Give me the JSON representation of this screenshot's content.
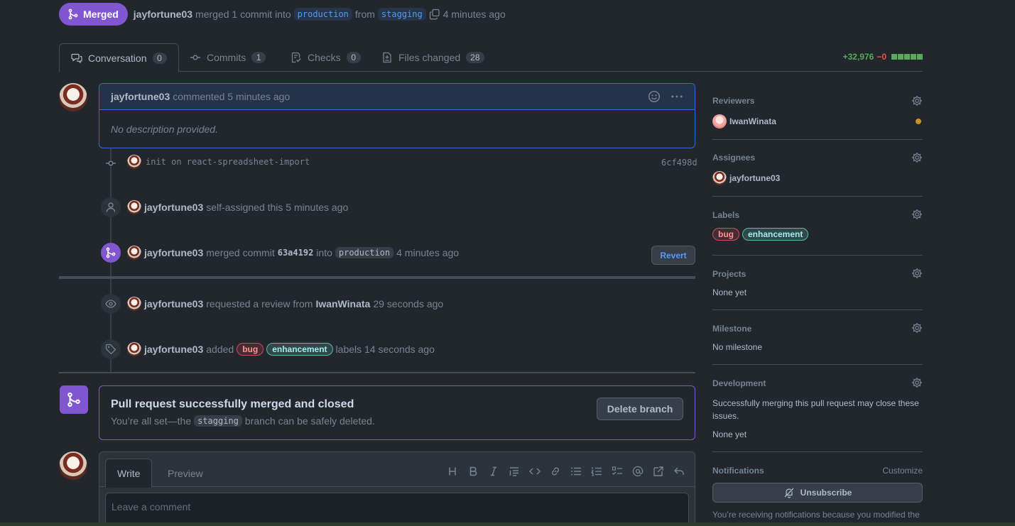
{
  "header": {
    "status": "Merged",
    "author": "jayfortune03",
    "merged_text": "merged 1 commit into",
    "base_branch": "production",
    "from_text": "from",
    "head_branch": "stagging",
    "time": "4 minutes ago"
  },
  "tabs": [
    {
      "label": "Conversation",
      "count": "0"
    },
    {
      "label": "Commits",
      "count": "1"
    },
    {
      "label": "Checks",
      "count": "0"
    },
    {
      "label": "Files changed",
      "count": "28"
    }
  ],
  "diffstat": {
    "additions": "+32,976",
    "deletions": "−0"
  },
  "comment": {
    "author": "jayfortune03",
    "action": "commented 5 minutes ago",
    "body": "No description provided."
  },
  "commit": {
    "message": "init on react-spreadsheet-import",
    "sha": "6cf498d"
  },
  "events": {
    "assigned": {
      "actor": "jayfortune03",
      "text": "self-assigned this 5 minutes ago"
    },
    "merged": {
      "actor": "jayfortune03",
      "text1": "merged commit",
      "sha": "63a4192",
      "text2": "into",
      "branch": "production",
      "time": "4 minutes ago",
      "revert_label": "Revert"
    },
    "review": {
      "actor": "jayfortune03",
      "text": "requested a review from",
      "reviewer": "IwanWinata",
      "time": "29 seconds ago"
    },
    "labels": {
      "actor": "jayfortune03",
      "text": "added",
      "label1": "bug",
      "label2": "enhancement",
      "time": "labels 14 seconds ago"
    }
  },
  "merge_box": {
    "title": "Pull request successfully merged and closed",
    "sub1": "You’re all set—the",
    "branch": "stagging",
    "sub2": "branch can be safely deleted.",
    "delete_label": "Delete branch"
  },
  "write": {
    "tab_write": "Write",
    "tab_preview": "Preview",
    "placeholder": "Leave a comment"
  },
  "sidebar": {
    "reviewers": {
      "title": "Reviewers",
      "user": "IwanWinata"
    },
    "assignees": {
      "title": "Assignees",
      "user": "jayfortune03"
    },
    "labels": {
      "title": "Labels",
      "label1": "bug",
      "label2": "enhancement"
    },
    "projects": {
      "title": "Projects",
      "value": "None yet"
    },
    "milestone": {
      "title": "Milestone",
      "value": "No milestone"
    },
    "development": {
      "title": "Development",
      "desc": "Successfully merging this pull request may close these issues.",
      "value": "None yet"
    },
    "notifications": {
      "title": "Notifications",
      "customize": "Customize",
      "unsubscribe": "Unsubscribe",
      "reason": "You’re receiving notifications because you modified the"
    }
  },
  "colors": {
    "merged": "#8256d0",
    "accent": "#539bf5",
    "add": "#57ab5a",
    "del": "#e5534b",
    "pending": "#c69026"
  }
}
